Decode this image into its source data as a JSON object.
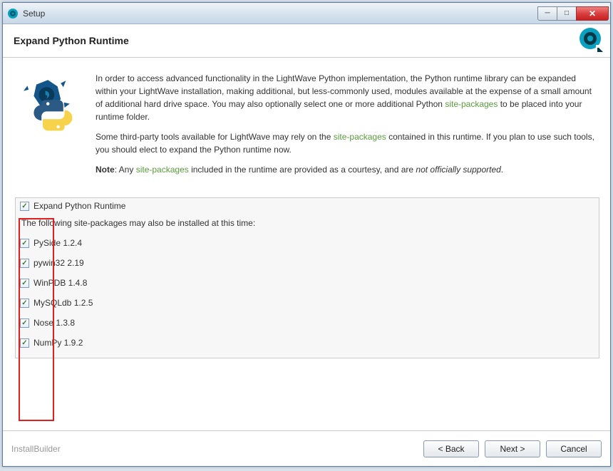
{
  "window": {
    "title": "Setup"
  },
  "header": {
    "title": "Expand Python Runtime"
  },
  "intro": {
    "p1a": "In order to access advanced functionality in the LightWave Python implementation, the Python runtime library can be expanded within your LightWave installation, making additional, but less-commonly used, modules available at the expense of a small amount of additional hard drive space. You may also optionally select one or more additional Python ",
    "p1_link": "site-packages",
    "p1b": " to be placed into your runtime folder.",
    "p2a": "Some third-party tools available for LightWave may rely on the ",
    "p2_link": "site-packages",
    "p2b": " contained in this runtime. If you plan to use such tools, you should elect to expand the Python runtime now.",
    "note_label": "Note",
    "note_a": ": Any ",
    "note_link": "site-packages",
    "note_b": " included in the runtime are provided as a courtesy, and are ",
    "note_italic": "not officially supported",
    "note_c": "."
  },
  "options": {
    "main_label": "Expand Python Runtime",
    "sub_label": "The following site-packages may also be installed at this time:",
    "items": [
      "PySide 1.2.4",
      "pywin32 2.19",
      "WinPDB 1.4.8",
      "MySQLdb 1.2.5",
      "Nose 1.3.8",
      "NumPy 1.9.2"
    ]
  },
  "footer": {
    "brand": "InstallBuilder",
    "back": "< Back",
    "next": "Next >",
    "cancel": "Cancel"
  }
}
